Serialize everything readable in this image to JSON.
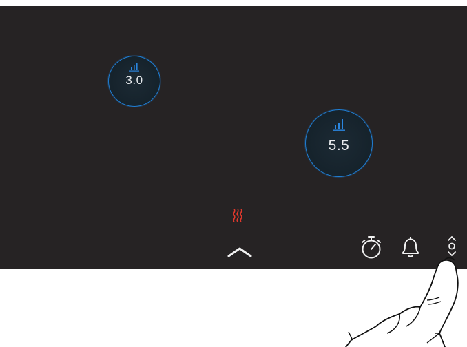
{
  "zones": [
    {
      "value": "3.0",
      "icon": "power-level-icon"
    },
    {
      "value": "5.5",
      "icon": "power-level-icon"
    }
  ],
  "status": {
    "icon": "heat-waves-icon",
    "color": "#e0382c"
  },
  "controls": {
    "expand_icon": "chevron-up-icon",
    "timer_icon": "timer-icon",
    "alarm_icon": "bell-icon",
    "scroll_icon": "up-down-chevron-icon"
  },
  "colors": {
    "panel_background": "#262324",
    "zone_ring": "#1f7fd6",
    "accent_blue": "#2a86e0",
    "heat_red": "#e0382c",
    "icon_white": "#f2f2f2"
  }
}
